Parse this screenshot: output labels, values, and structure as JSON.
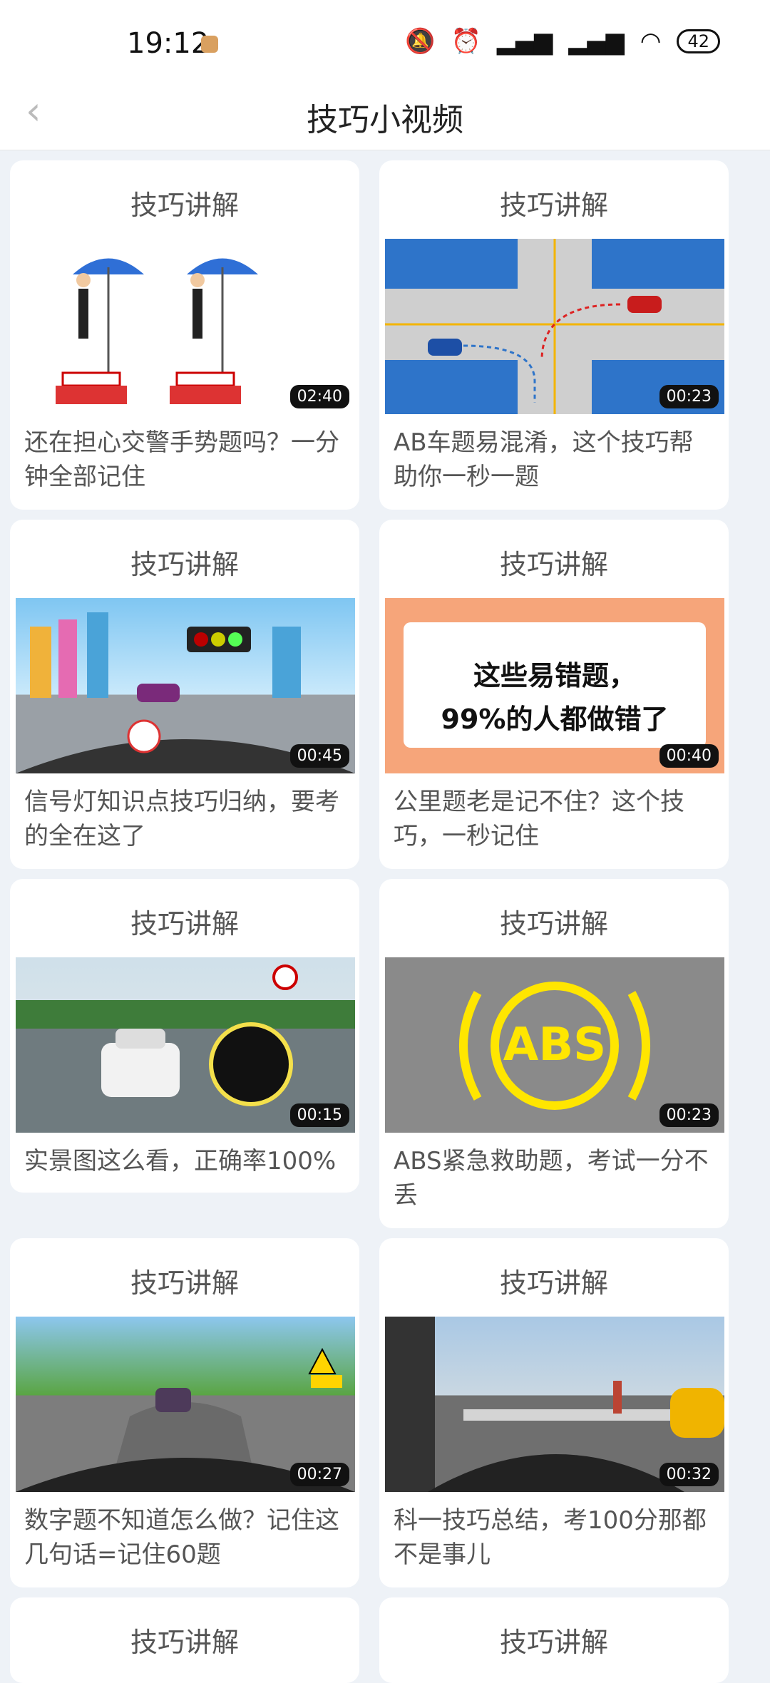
{
  "status": {
    "time": "19:12",
    "battery": "42"
  },
  "header": {
    "title": "技巧小视频"
  },
  "videos": [
    {
      "tag": "技巧讲解",
      "duration": "02:40",
      "desc": "还在担心交警手势题吗？一分钟全部记住"
    },
    {
      "tag": "技巧讲解",
      "duration": "00:23",
      "desc": "AB车题易混淆，这个技巧帮助你一秒一题"
    },
    {
      "tag": "技巧讲解",
      "duration": "00:45",
      "desc": "信号灯知识点技巧归纳，要考的全在这了"
    },
    {
      "tag": "技巧讲解",
      "duration": "00:40",
      "desc": "公里题老是记不住？这个技巧，一秒记住",
      "thumb_text_line1": "这些易错题，",
      "thumb_text_line2": "99%的人都做错了"
    },
    {
      "tag": "技巧讲解",
      "duration": "00:15",
      "desc": "实景图这么看，正确率100%"
    },
    {
      "tag": "技巧讲解",
      "duration": "00:23",
      "desc": "ABS紧急救助题，考试一分不丢",
      "thumb_text": "ABS"
    },
    {
      "tag": "技巧讲解",
      "duration": "00:27",
      "desc": "数字题不知道怎么做？记住这几句话=记住60题"
    },
    {
      "tag": "技巧讲解",
      "duration": "00:32",
      "desc": "科一技巧总结，考100分那都不是事儿"
    },
    {
      "tag": "技巧讲解"
    },
    {
      "tag": "技巧讲解"
    }
  ]
}
